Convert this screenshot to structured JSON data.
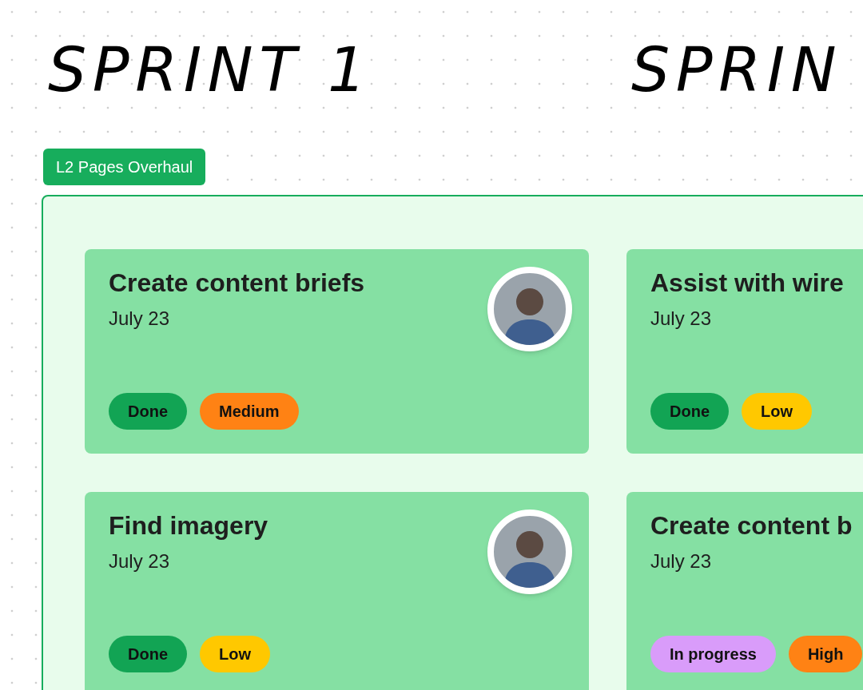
{
  "headings": [
    {
      "text": "SPRINT 1"
    },
    {
      "text": "SPRIN"
    }
  ],
  "section": {
    "label": "L2 Pages Overhaul",
    "cards": [
      {
        "title": "Create content briefs",
        "date": "July 23",
        "avatar": true,
        "tags": [
          {
            "label": "Done",
            "color": "#12a454"
          },
          {
            "label": "Medium",
            "color": "#ff8214"
          }
        ]
      },
      {
        "title": "Assist with wire",
        "date": "July 23",
        "tags": [
          {
            "label": "Done",
            "color": "#12a454"
          },
          {
            "label": "Low",
            "color": "#ffc800"
          }
        ]
      },
      {
        "title": "Find imagery",
        "date": "July 23",
        "avatar": true,
        "tags": [
          {
            "label": "Done",
            "color": "#12a454"
          },
          {
            "label": "Low",
            "color": "#ffc800"
          }
        ]
      },
      {
        "title": "Create content b",
        "date": "July 23",
        "tags": [
          {
            "label": "In progress",
            "color": "#d99cfa"
          },
          {
            "label": "High",
            "color": "#ff8214"
          }
        ]
      }
    ]
  }
}
